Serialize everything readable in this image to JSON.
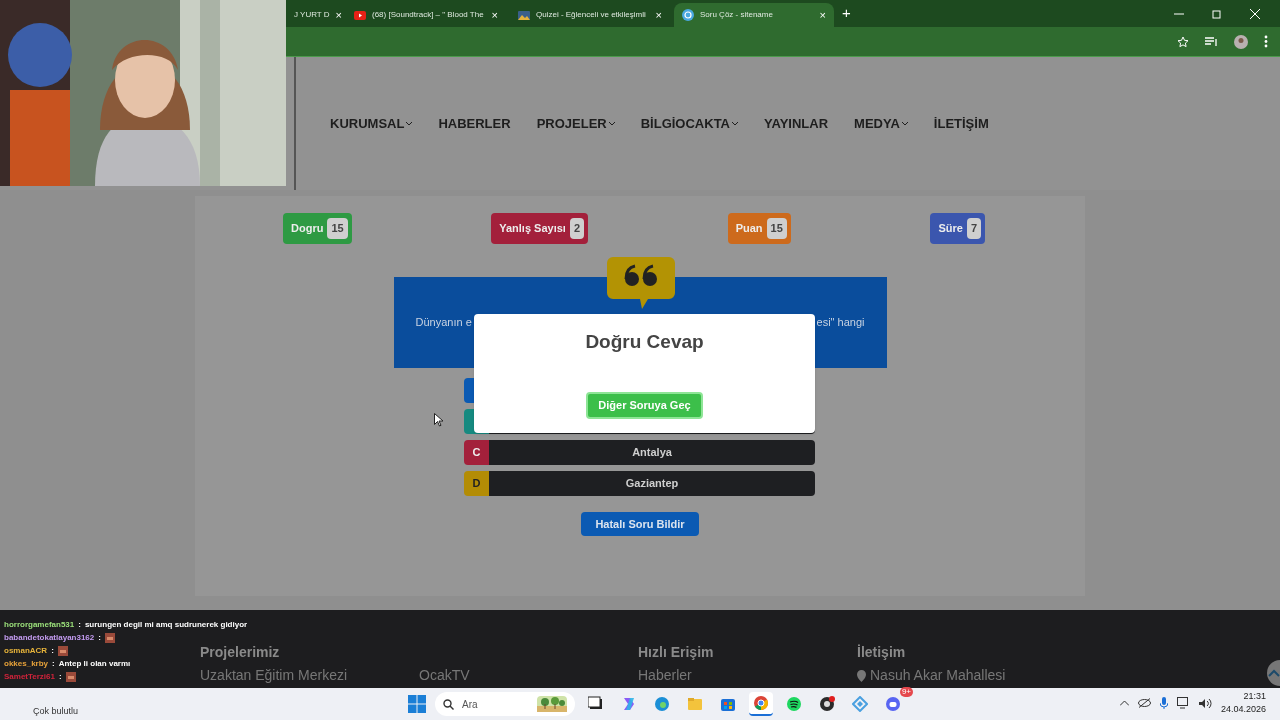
{
  "browser": {
    "tabs": [
      {
        "title": "J YURT D",
        "close": "×",
        "selected": false,
        "kind": "plain"
      },
      {
        "title": "(68) [Soundtrack] – \" Blood The",
        "close": "×",
        "selected": false,
        "kind": "video"
      },
      {
        "title": "Quizei - Eğlenceli ve etkileşimli",
        "close": "×",
        "selected": false,
        "kind": "quiz"
      },
      {
        "title": "Soru Çöz - sitename",
        "close": "×",
        "selected": true,
        "kind": "site"
      }
    ],
    "new_tab": "+"
  },
  "nav": {
    "items": [
      {
        "label": "KURUMSAL",
        "dropdown": true
      },
      {
        "label": "HABERLER",
        "dropdown": false
      },
      {
        "label": "PROJELER",
        "dropdown": true
      },
      {
        "label": "BİLGİOCAKTA",
        "dropdown": true
      },
      {
        "label": "YAYINLAR",
        "dropdown": false
      },
      {
        "label": "MEDYA",
        "dropdown": true
      },
      {
        "label": "İLETİŞİM",
        "dropdown": false
      }
    ]
  },
  "stats": [
    {
      "label": "Dogru",
      "value": "15",
      "color": "#2e9a43"
    },
    {
      "label": "Yanlış Sayısı",
      "value": "2",
      "color": "#a3203b"
    },
    {
      "label": "Puan",
      "value": "15",
      "color": "#cd6a1c"
    },
    {
      "label": "Süre",
      "value": "7",
      "color": "#3b56ae"
    }
  ],
  "question": {
    "left_part": "Dünyanın e",
    "right_part": "esi\" hangi"
  },
  "answers": [
    {
      "color": "#0b5ab3"
    },
    {
      "color": "#168a80"
    },
    {
      "letter": "C",
      "text": "Antalya",
      "color": "#a3203b"
    },
    {
      "letter": "D",
      "text": "Gaziantep",
      "color": "#b38c05"
    }
  ],
  "report_button": "Hatalı Soru Bildir",
  "modal": {
    "title": "Doğru Cevap",
    "button": "Diğer Soruya Geç"
  },
  "footer": {
    "columns": [
      {
        "title": "Projelerimiz",
        "links": [
          "Uzaktan Eğitim Merkezi",
          "OcakTV"
        ]
      },
      {
        "title": "Hızlı Erişim",
        "links": [
          "Haberler"
        ]
      },
      {
        "title": "İletişim",
        "links": [
          "Nasuh Akar Mahallesi"
        ]
      }
    ]
  },
  "chat": [
    {
      "user": "horrorgamefan531",
      "separator": ":",
      "message": "surungen degil mi amq sudrunerek gidiyor",
      "color": "#9be07a",
      "emote": false
    },
    {
      "user": "babandetokatlayan3162",
      "separator": ":",
      "color": "#c39bf0",
      "emote": true
    },
    {
      "user": "osmanACR",
      "separator": ":",
      "color": "#e7b43a",
      "emote": true
    },
    {
      "user": "okkes_krby",
      "separator": ":",
      "message": "Antep li olan varmı",
      "color": "#e7a23a",
      "emote": false
    },
    {
      "user": "SametTerzi61",
      "separator": ":",
      "color": "#d0233a",
      "emote": true
    }
  ],
  "taskbar": {
    "weather": "Çok bulutlu",
    "search_placeholder": "Ara",
    "apps": [
      {
        "kind": "taskview",
        "selected": false
      },
      {
        "kind": "copilot",
        "selected": false
      },
      {
        "kind": "edge",
        "selected": false
      },
      {
        "kind": "files",
        "selected": false
      },
      {
        "kind": "store",
        "selected": false
      },
      {
        "kind": "chrome",
        "selected": true
      },
      {
        "kind": "spotify",
        "selected": false
      },
      {
        "kind": "obs",
        "selected": false
      },
      {
        "kind": "app",
        "selected": false
      },
      {
        "kind": "discord",
        "selected": false,
        "badge": "9+"
      }
    ],
    "time": "21:31",
    "date": "24.04.2026"
  }
}
